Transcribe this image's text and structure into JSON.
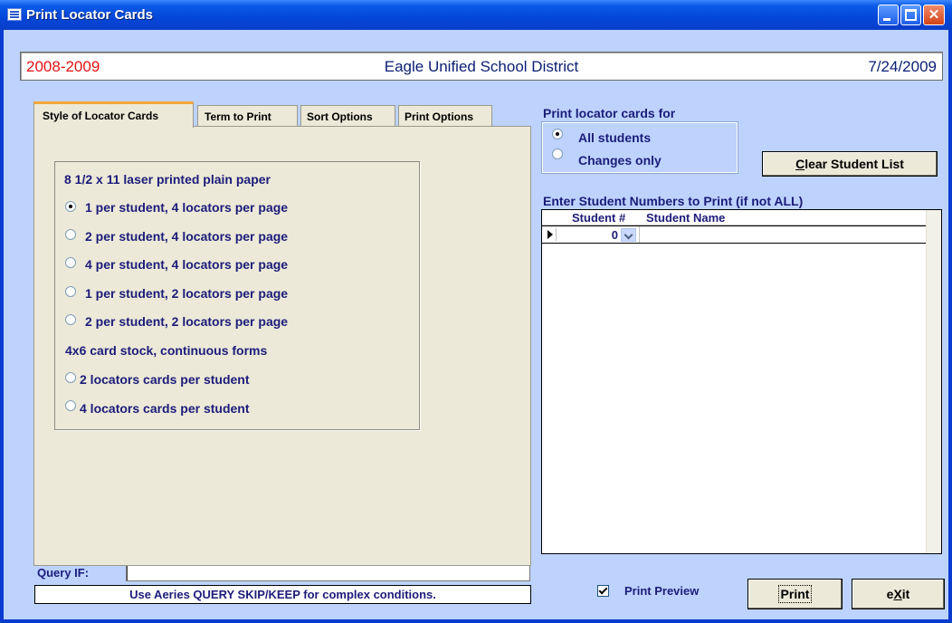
{
  "window": {
    "title": "Print Locator Cards"
  },
  "header": {
    "school_year": "2008-2009",
    "district": "Eagle Unified School District",
    "date": "7/24/2009"
  },
  "tabs": [
    {
      "label": "Style of Locator Cards",
      "selected": true
    },
    {
      "label": "Term to Print",
      "selected": false
    },
    {
      "label": "Sort Options",
      "selected": false
    },
    {
      "label": "Print Options",
      "selected": false
    }
  ],
  "style_options": {
    "group1_label": "8 1/2 x 11 laser printed plain paper",
    "group1": [
      {
        "label": "1 per student, 4 locators per page",
        "checked": true
      },
      {
        "label": "2 per student, 4 locators per page",
        "checked": false
      },
      {
        "label": "4 per student, 4 locators per page",
        "checked": false
      },
      {
        "label": "1 per student, 2 locators per page",
        "checked": false
      },
      {
        "label": "2 per student, 2 locators per page",
        "checked": false
      }
    ],
    "group2_label": "4x6 card stock, continuous forms",
    "group2": [
      {
        "label": "2 locators cards per student",
        "checked": false
      },
      {
        "label": "4 locators cards per student",
        "checked": false
      }
    ]
  },
  "query": {
    "label": "Query IF:",
    "value": "",
    "hint": "Use Aeries QUERY SKIP/KEEP for complex conditions."
  },
  "print_for": {
    "label": "Print locator cards for",
    "options": [
      {
        "label": "All students",
        "checked": true
      },
      {
        "label": "Changes only",
        "checked": false
      }
    ]
  },
  "clear_button": {
    "mnemonic": "C",
    "rest": "lear Student List"
  },
  "student_list": {
    "label": "Enter Student Numbers to Print (if not ALL)",
    "columns": [
      "Student #",
      "Student Name"
    ],
    "rows": [
      {
        "number": "0",
        "name": ""
      }
    ]
  },
  "print_preview": {
    "label": "Print Preview",
    "checked": true
  },
  "print_button": {
    "label": "Print"
  },
  "exit_button": {
    "pre": "e",
    "mnemonic": "X",
    "post": "it"
  }
}
